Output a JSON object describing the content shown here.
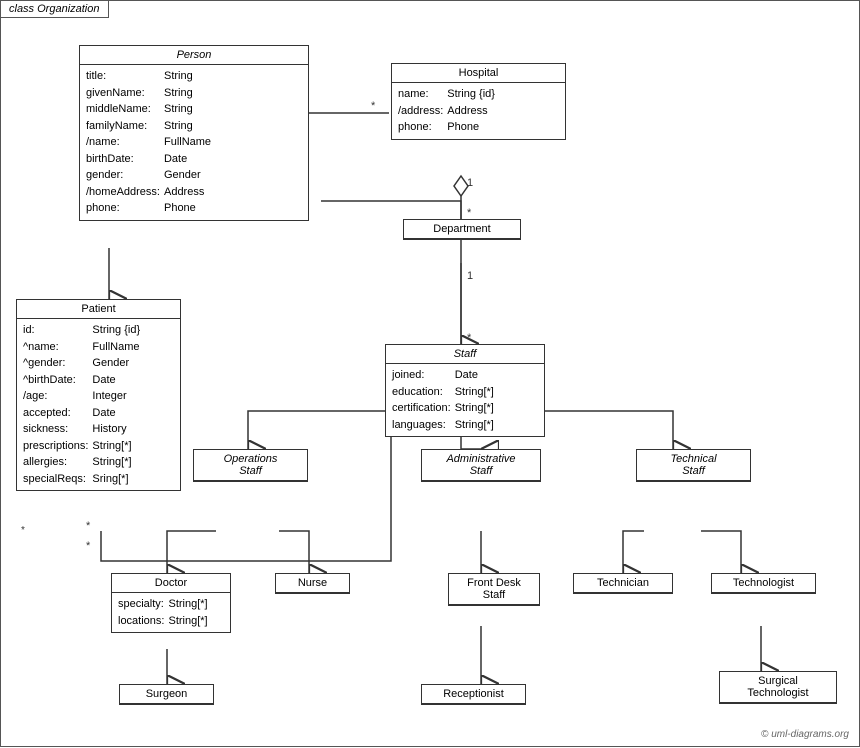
{
  "diagram": {
    "title": "class Organization",
    "copyright": "© uml-diagrams.org",
    "boxes": {
      "person": {
        "title": "Person",
        "italic": true,
        "attrs": [
          [
            "title:",
            "String"
          ],
          [
            "givenName:",
            "String"
          ],
          [
            "middleName:",
            "String"
          ],
          [
            "familyName:",
            "String"
          ],
          [
            "/name:",
            "FullName"
          ],
          [
            "birthDate:",
            "Date"
          ],
          [
            "gender:",
            "Gender"
          ],
          [
            "/homeAddress:",
            "Address"
          ],
          [
            "phone:",
            "Phone"
          ]
        ]
      },
      "hospital": {
        "title": "Hospital",
        "attrs": [
          [
            "name:",
            "String {id}"
          ],
          [
            "/address:",
            "Address"
          ],
          [
            "phone:",
            "Phone"
          ]
        ]
      },
      "department": {
        "title": "Department",
        "attrs": []
      },
      "staff": {
        "title": "Staff",
        "italic": true,
        "attrs": [
          [
            "joined:",
            "Date"
          ],
          [
            "education:",
            "String[*]"
          ],
          [
            "certification:",
            "String[*]"
          ],
          [
            "languages:",
            "String[*]"
          ]
        ]
      },
      "patient": {
        "title": "Patient",
        "attrs": [
          [
            "id:",
            "String {id}"
          ],
          [
            "^name:",
            "FullName"
          ],
          [
            "^gender:",
            "Gender"
          ],
          [
            "^birthDate:",
            "Date"
          ],
          [
            "/age:",
            "Integer"
          ],
          [
            "accepted:",
            "Date"
          ],
          [
            "sickness:",
            "History"
          ],
          [
            "prescriptions:",
            "String[*]"
          ],
          [
            "allergies:",
            "String[*]"
          ],
          [
            "specialReqs:",
            "Sring[*]"
          ]
        ]
      },
      "operationsStaff": {
        "title": "Operations\nStaff",
        "italic": true,
        "attrs": []
      },
      "administrativeStaff": {
        "title": "Administrative\nStaff",
        "italic": true,
        "attrs": []
      },
      "technicalStaff": {
        "title": "Technical\nStaff",
        "italic": true,
        "attrs": []
      },
      "doctor": {
        "title": "Doctor",
        "attrs": [
          [
            "specialty:",
            "String[*]"
          ],
          [
            "locations:",
            "String[*]"
          ]
        ]
      },
      "nurse": {
        "title": "Nurse",
        "attrs": []
      },
      "frontDeskStaff": {
        "title": "Front Desk\nStaff",
        "attrs": []
      },
      "technician": {
        "title": "Technician",
        "attrs": []
      },
      "technologist": {
        "title": "Technologist",
        "attrs": []
      },
      "surgeon": {
        "title": "Surgeon",
        "attrs": []
      },
      "receptionist": {
        "title": "Receptionist",
        "attrs": []
      },
      "surgicalTechnologist": {
        "title": "Surgical\nTechnologist",
        "attrs": []
      }
    }
  }
}
